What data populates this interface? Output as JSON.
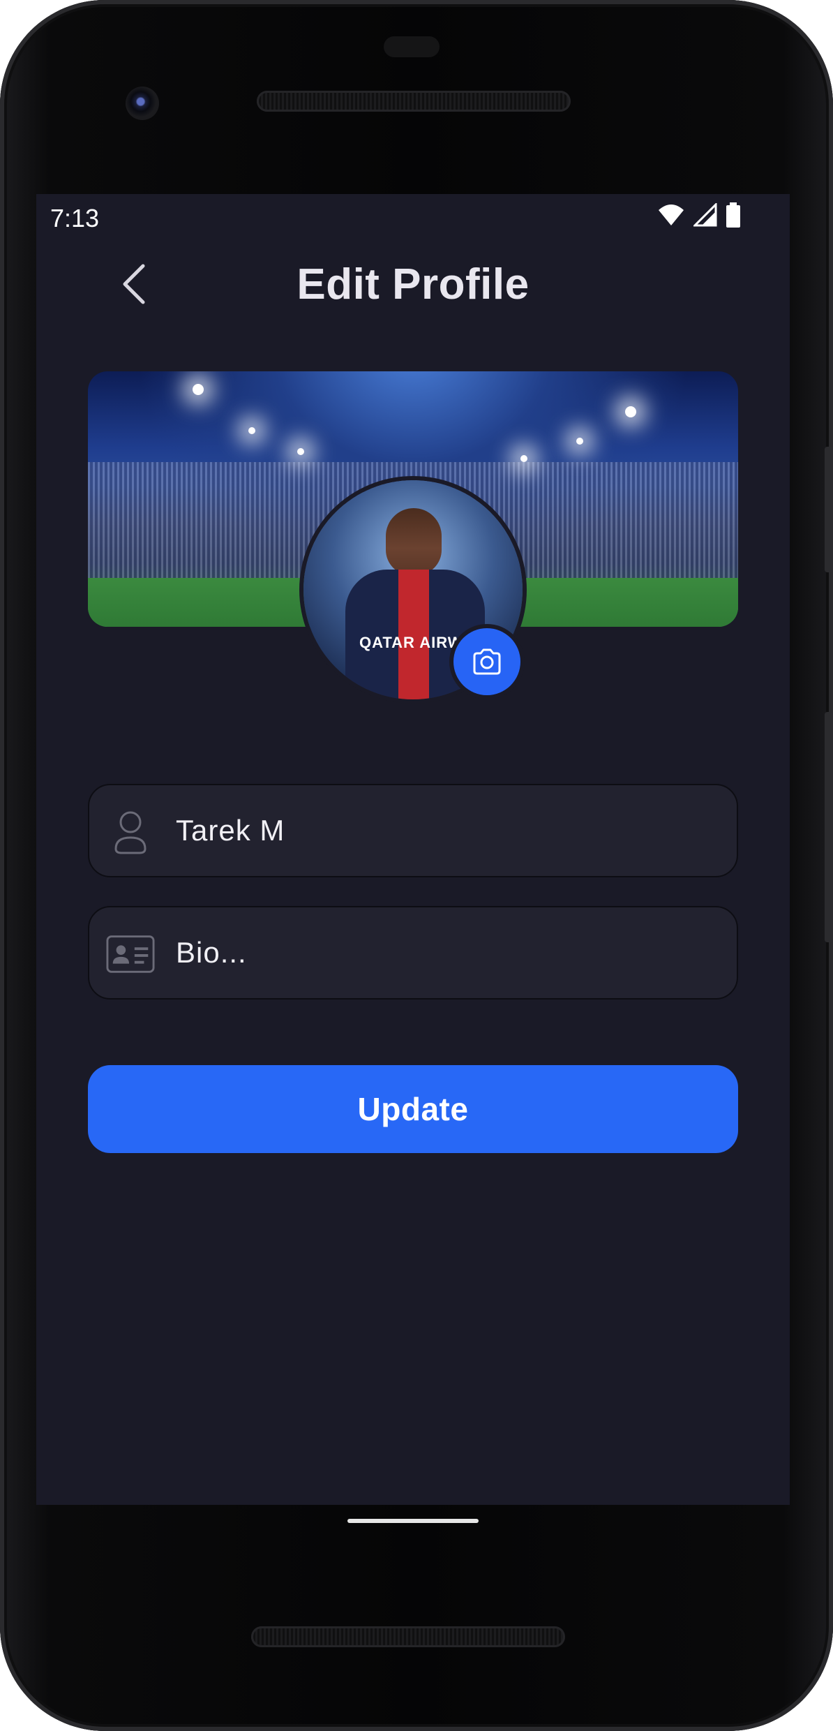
{
  "status_bar": {
    "time": "7:13",
    "icons": [
      "wifi-icon",
      "cell-signal-icon",
      "battery-icon"
    ]
  },
  "header": {
    "title": "Edit Profile",
    "back_icon": "chevron-left-icon"
  },
  "profile": {
    "avatar_sponsor_text": "QATAR AIRWAYS",
    "camera_icon": "camera-icon"
  },
  "form": {
    "name": {
      "value": "Tarek M",
      "icon": "person-icon"
    },
    "bio": {
      "placeholder": "Bio...",
      "icon": "id-card-icon"
    }
  },
  "actions": {
    "update_label": "Update"
  },
  "colors": {
    "screen_bg": "#1a1a27",
    "field_bg": "#22222f",
    "accent": "#2868f6",
    "title_text": "#e9e7ef"
  }
}
